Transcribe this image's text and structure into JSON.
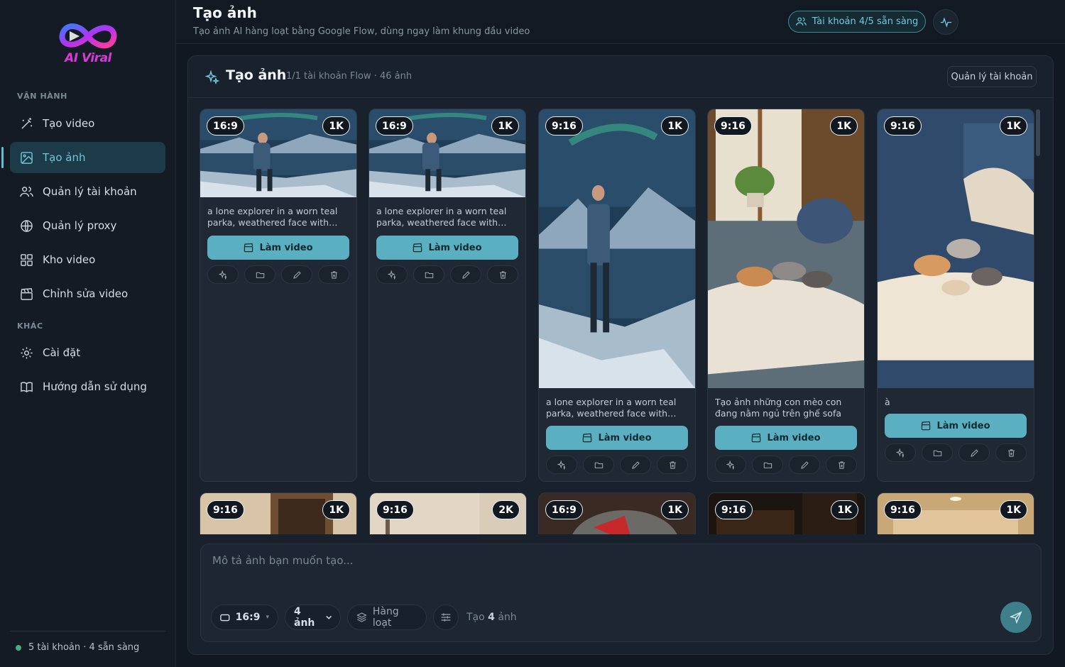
{
  "brand": {
    "name": "AI Viral"
  },
  "sidebar": {
    "section_ops": "VẬN HÀNH",
    "section_other": "KHÁC",
    "items": [
      {
        "label": "Tạo video",
        "icon": "magic-wand-icon"
      },
      {
        "label": "Tạo ảnh",
        "icon": "image-icon",
        "active": true
      },
      {
        "label": "Quản lý tài khoản",
        "icon": "users-icon"
      },
      {
        "label": "Quản lý proxy",
        "icon": "globe-icon"
      },
      {
        "label": "Kho video",
        "icon": "grid-icon"
      },
      {
        "label": "Chỉnh sửa video",
        "icon": "clapperboard-icon"
      }
    ],
    "other_items": [
      {
        "label": "Cài đặt",
        "icon": "gear-icon"
      },
      {
        "label": "Hướng dẫn sử dụng",
        "icon": "book-icon"
      }
    ],
    "status": "5 tài khoản · 4 sẵn sàng"
  },
  "header": {
    "title": "Tạo ảnh",
    "subtitle": "Tạo ảnh AI hàng loạt bằng Google Flow, dùng ngay làm khung đầu video",
    "account_pill": "Tài khoản 4/5 sẵn sàng"
  },
  "panel": {
    "title": "Tạo ảnh",
    "meta": "1/1 tài khoản Flow · 46 ảnh",
    "manage_button": "Quản lý tài khoản"
  },
  "cards": [
    {
      "ratio": "16:9",
      "res": "1K",
      "caption": "a lone explorer in a worn teal parka, weathered face with fros...",
      "button": "Làm video",
      "scene": "explorer"
    },
    {
      "ratio": "16:9",
      "res": "1K",
      "caption": "a lone explorer in a worn teal parka, weathered face with fros...",
      "button": "Làm video",
      "scene": "explorer"
    },
    {
      "ratio": "9:16",
      "res": "1K",
      "caption": "a lone explorer in a worn teal parka, weathered face with fros...",
      "button": "Làm video",
      "scene": "explorer"
    },
    {
      "ratio": "9:16",
      "res": "1K",
      "caption": "Tạo ảnh những con mèo con đang nằm ngủ trên ghế sofa",
      "button": "Làm video",
      "scene": "kittens-window"
    },
    {
      "ratio": "9:16",
      "res": "1K",
      "caption": "à",
      "button": "Làm video",
      "scene": "kittens-sofa"
    },
    {
      "ratio": "9:16",
      "res": "1K",
      "scene": "room"
    },
    {
      "ratio": "9:16",
      "res": "2K",
      "scene": "room-light"
    },
    {
      "ratio": "16:9",
      "res": "1K",
      "scene": "leaf"
    },
    {
      "ratio": "9:16",
      "res": "1K",
      "scene": "dark-room"
    },
    {
      "ratio": "9:16",
      "res": "1K",
      "scene": "hall"
    }
  ],
  "prompt": {
    "placeholder": "Mô tả ảnh bạn muốn tạo...",
    "ratio": "16:9",
    "count": "4 ảnh",
    "batch": "Hàng loạt",
    "hint_prefix": "Tạo",
    "hint_count": "4",
    "hint_suffix": "ảnh"
  },
  "colors": {
    "accent": "#5ab0c0",
    "background": "#111821",
    "panel": "#18212c"
  }
}
